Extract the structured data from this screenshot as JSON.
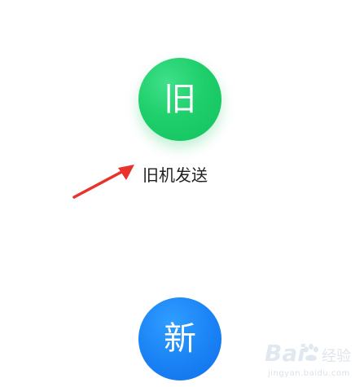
{
  "old_device": {
    "icon_glyph": "旧",
    "label": "旧机发送",
    "color": "#1fcf6b"
  },
  "new_device": {
    "icon_glyph": "新",
    "color": "#1a82f5"
  },
  "annotation": {
    "arrow_color": "#e8322b"
  },
  "watermark": {
    "brand": "Bai",
    "brand_suffix": "经验",
    "url": "jingyan.baidu.com"
  }
}
